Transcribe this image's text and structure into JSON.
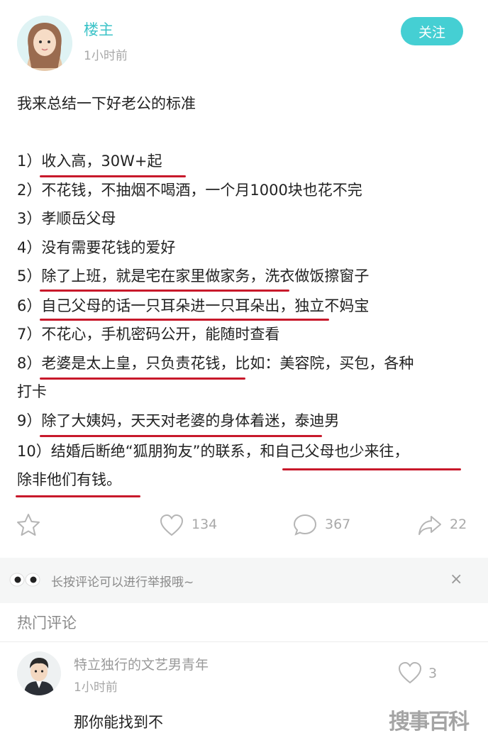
{
  "post": {
    "author": "楼主",
    "time": "1小时前",
    "follow_label": "关注",
    "lines": [
      "我来总结一下好老公的标准",
      "1）收入高，30W+起",
      "2）不花钱，不抽烟不喝酒，一个月1000块也花不完",
      "3）孝顺岳父母",
      "4）没有需要花钱的爱好",
      "5）除了上班，就是宅在家里做家务，洗衣做饭擦窗子",
      "6）自己父母的话一只耳朵进一只耳朵出，独立不妈宝",
      "7）不花心，手机密码公开，能随时查看",
      "8）老婆是太上皇，只负责花钱，比如：美容院，买包，各种",
      "打卡",
      "9）除了大姨妈，天天对老婆的身体着迷，泰迪男",
      "10）结婚后断绝“狐朋狗友”的联系，和自己父母也少来往，",
      "除非他们有钱。"
    ],
    "actions": {
      "like_count": "134",
      "comment_count": "367",
      "share_count": "22"
    }
  },
  "notice": {
    "text": "长按评论可以进行举报哦~",
    "close": "×"
  },
  "hot_comments": {
    "title": "热门评论",
    "items": [
      {
        "user": "特立独行的文艺男青年",
        "time": "1小时前",
        "text": "那你能找到不",
        "likes": "3"
      }
    ]
  },
  "watermark": "搜事百科",
  "colors": {
    "accent": "#45cfd3",
    "underline": "#c8192b"
  },
  "icons": [
    "star-icon",
    "heart-icon",
    "comment-bubble-icon",
    "share-arrow-icon",
    "eyes-icon",
    "close-icon"
  ]
}
